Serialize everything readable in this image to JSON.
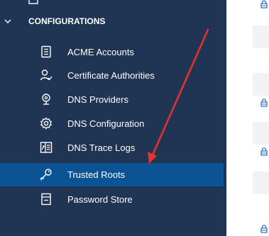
{
  "sidebar": {
    "section_title": "CONFIGURATIONS",
    "items": [
      {
        "label": "ACME Accounts",
        "icon": "document-list-icon"
      },
      {
        "label": "Certificate Authorities",
        "icon": "user-check-icon"
      },
      {
        "label": "DNS Providers",
        "icon": "location-pin-icon"
      },
      {
        "label": "DNS Configuration",
        "icon": "gear-icon"
      },
      {
        "label": "DNS Trace Logs",
        "icon": "trace-log-icon"
      },
      {
        "label": "Trusted Roots",
        "icon": "key-icon",
        "active": true
      },
      {
        "label": "Password Store",
        "icon": "password-store-icon"
      }
    ]
  },
  "colors": {
    "sidebar_bg": "#1f3553",
    "active_bg": "#0b5394",
    "annotation_arrow": "#e8332a",
    "lock_icon": "#2f6fb3"
  }
}
